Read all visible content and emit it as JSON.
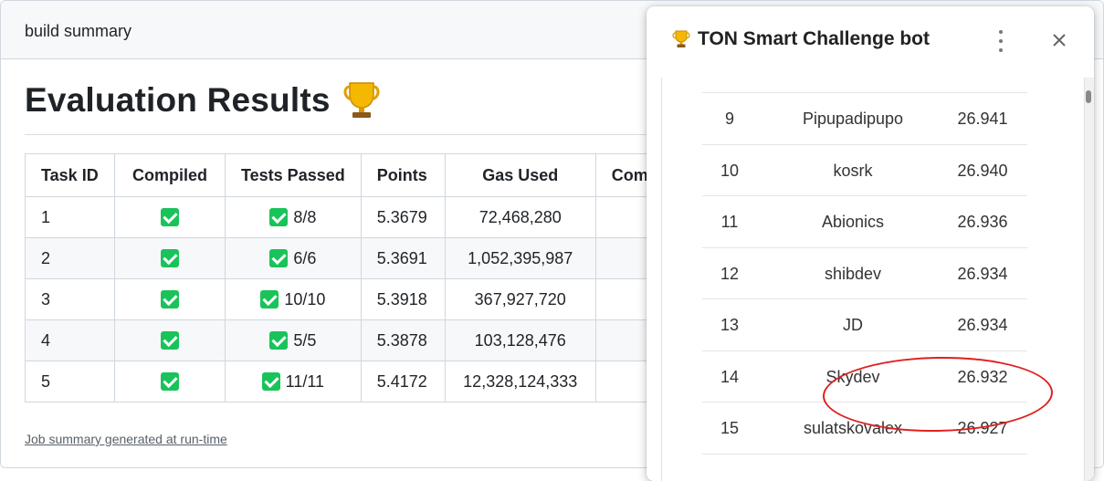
{
  "summary": {
    "header_title": "build summary",
    "eval_title": "Evaluation Results",
    "trophy_icon": "trophy-icon",
    "footer_link": "Job summary generated at run-time",
    "columns": [
      "Task ID",
      "Compiled",
      "Tests Passed",
      "Points",
      "Gas Used",
      "Comp"
    ],
    "rows": [
      {
        "task": "1",
        "tests": "8/8",
        "points": "5.3679",
        "gas": "72,468,280"
      },
      {
        "task": "2",
        "tests": "6/6",
        "points": "5.3691",
        "gas": "1,052,395,987"
      },
      {
        "task": "3",
        "tests": "10/10",
        "points": "5.3918",
        "gas": "367,927,720"
      },
      {
        "task": "4",
        "tests": "5/5",
        "points": "5.3878",
        "gas": "103,128,476"
      },
      {
        "task": "5",
        "tests": "11/11",
        "points": "5.4172",
        "gas": "12,328,124,333"
      }
    ],
    "check_color": "#19c35a"
  },
  "popup": {
    "title": "TON Smart Challenge bot",
    "menu_icon": "kebab-menu-icon",
    "close_icon": "close-icon",
    "leaderboard": [
      {
        "rank": "9",
        "name": "Pipupadipupo",
        "score": "26.941"
      },
      {
        "rank": "10",
        "name": "kosrk",
        "score": "26.940"
      },
      {
        "rank": "11",
        "name": "Abionics",
        "score": "26.936"
      },
      {
        "rank": "12",
        "name": "shibdev",
        "score": "26.934"
      },
      {
        "rank": "13",
        "name": "JD",
        "score": "26.934"
      },
      {
        "rank": "14",
        "name": "Skydev",
        "score": "26.932"
      },
      {
        "rank": "15",
        "name": "sulatskovalex",
        "score": "26.927"
      }
    ],
    "highlight_color": "#e02020"
  }
}
